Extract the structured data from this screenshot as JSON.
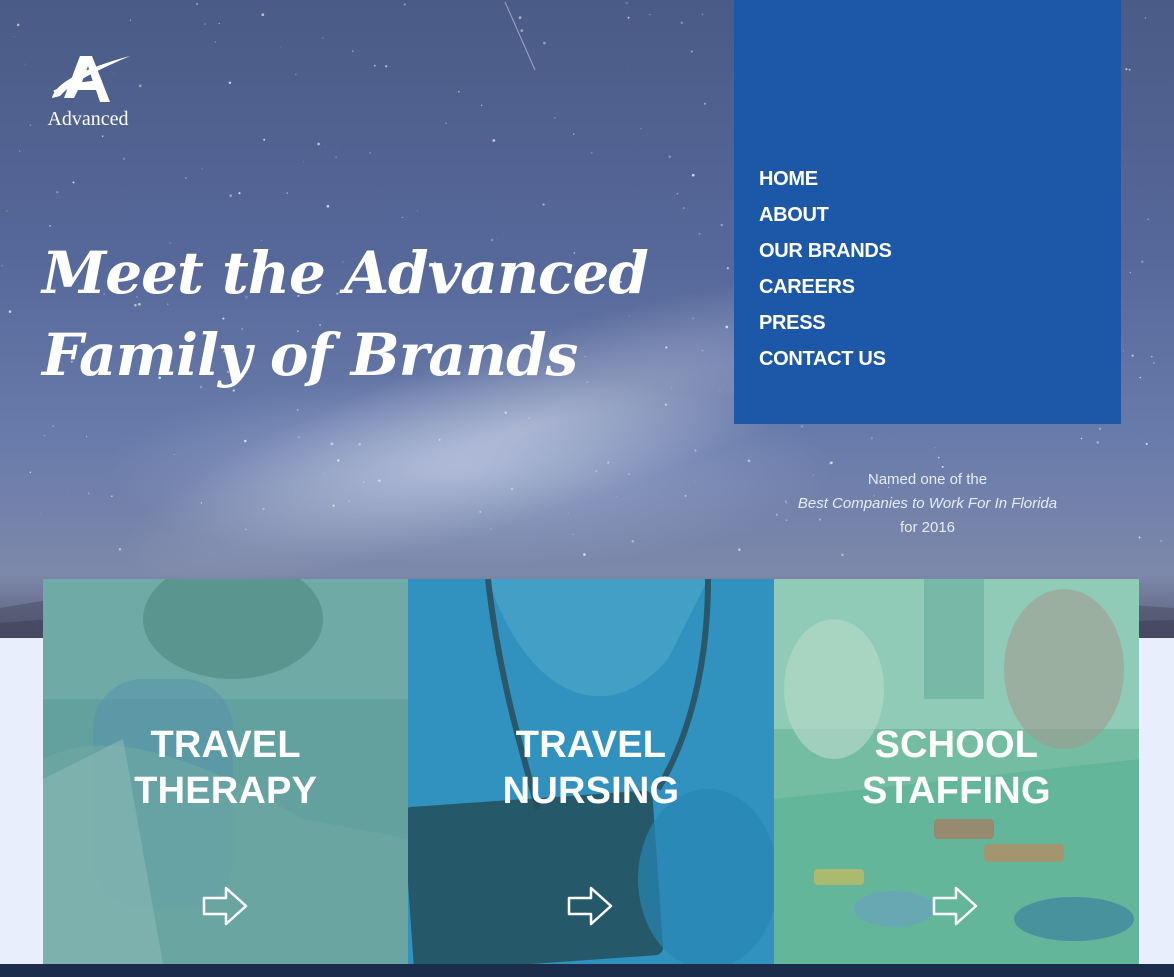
{
  "brand": {
    "logo_text": "Advanced",
    "colors": {
      "nav_panel": "#1d58a8",
      "footer": "#1b2d4a",
      "page_bg": "#e8eefc"
    }
  },
  "hero": {
    "headline_line1": "Meet the Advanced",
    "headline_line2": "Family of Brands"
  },
  "nav": {
    "items": [
      {
        "label": "HOME"
      },
      {
        "label": "ABOUT"
      },
      {
        "label": "OUR BRANDS"
      },
      {
        "label": "CAREERS"
      },
      {
        "label": "PRESS"
      },
      {
        "label": "CONTACT US"
      }
    ]
  },
  "award": {
    "line1": "Named one of the",
    "line2": "Best Companies to Work For In Florida",
    "line3": "for 2016"
  },
  "cards": [
    {
      "title_line1": "TRAVEL",
      "title_line2": "THERAPY",
      "icon": "arrow-right-icon"
    },
    {
      "title_line1": "TRAVEL",
      "title_line2": "NURSING",
      "icon": "arrow-right-icon"
    },
    {
      "title_line1": "SCHOOL",
      "title_line2": "STAFFING",
      "icon": "arrow-right-icon"
    }
  ]
}
